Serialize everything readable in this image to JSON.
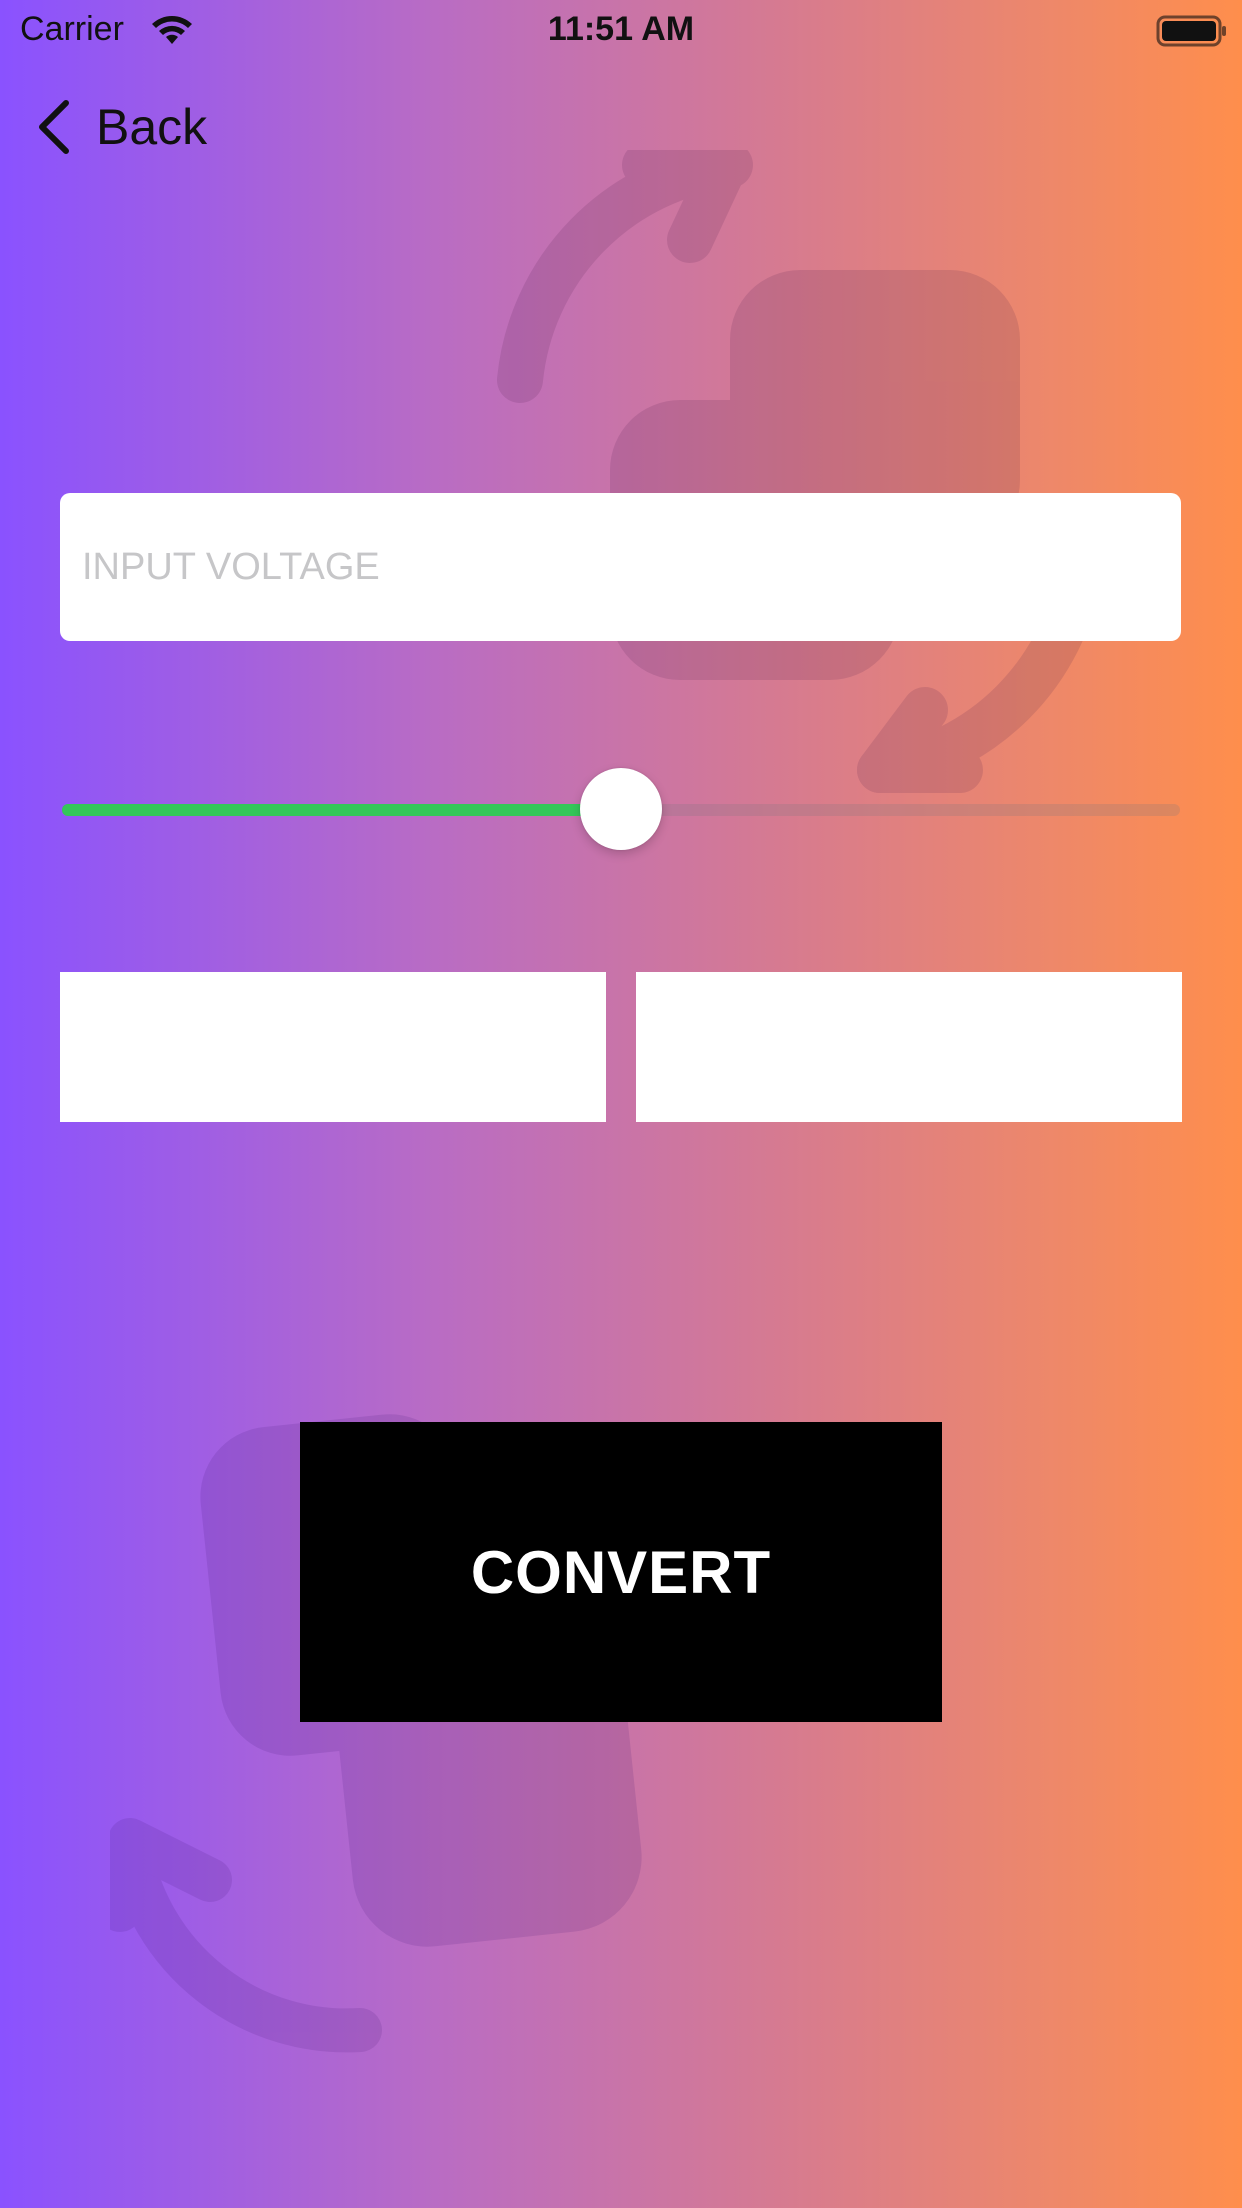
{
  "status_bar": {
    "carrier": "Carrier",
    "time": "11:51 AM",
    "wifi_icon": "wifi-icon",
    "battery_icon": "battery-icon"
  },
  "nav": {
    "back_label": "Back",
    "back_icon": "chevron-left-icon"
  },
  "voltage_input": {
    "placeholder": "INPUT VOLTAGE",
    "value": ""
  },
  "slider": {
    "value": 0.5,
    "fill_color": "#34c759"
  },
  "outputs": {
    "left_value": "",
    "right_value": ""
  },
  "convert_button": {
    "label": "CONVERT"
  },
  "background": {
    "gradient": [
      "#8a52ff",
      "#ff8e4c"
    ],
    "decoration_icon": "rotate-convert-icon"
  }
}
